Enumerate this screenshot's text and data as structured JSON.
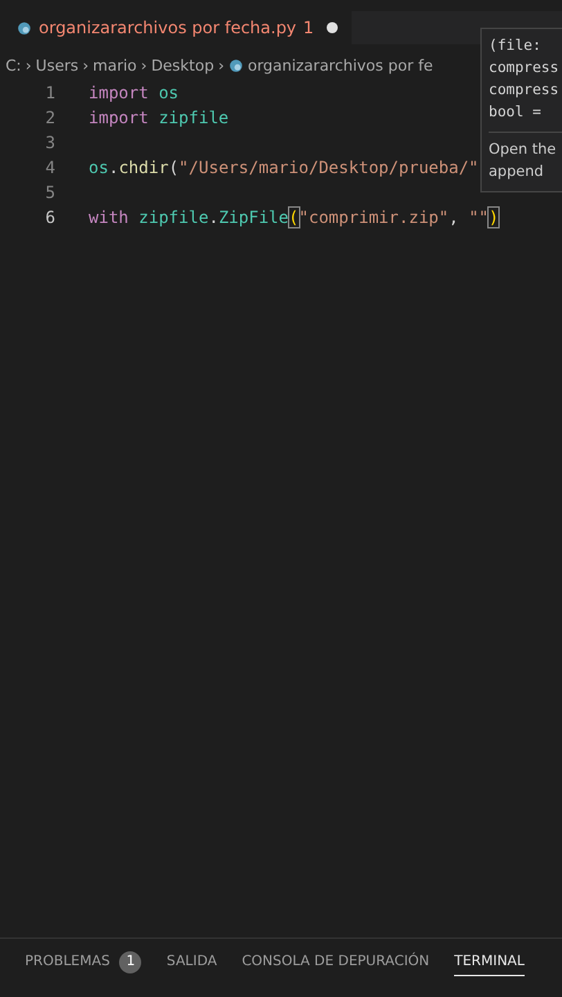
{
  "tabs": [
    {
      "label": "organizararchivos por fecha.py",
      "problems": "1",
      "modified": true,
      "selected": true
    }
  ],
  "breadcrumb": {
    "separator": "›",
    "items": [
      "C:",
      "Users",
      "mario",
      "Desktop",
      "organizararchivos por fe"
    ]
  },
  "code": [
    {
      "number": "1",
      "current": false,
      "tokens": [
        {
          "kind": "keyword",
          "text": "import "
        },
        {
          "kind": "module",
          "text": "os"
        }
      ]
    },
    {
      "number": "2",
      "current": false,
      "tokens": [
        {
          "kind": "keyword",
          "text": "import "
        },
        {
          "kind": "module",
          "text": "zipfile"
        }
      ]
    },
    {
      "number": "3",
      "current": false
    },
    {
      "number": "4",
      "current": false,
      "tokens": [
        {
          "kind": "module",
          "text": "os"
        },
        {
          "kind": "plain",
          "text": "."
        },
        {
          "kind": "function",
          "text": "chdir"
        },
        {
          "kind": "plain",
          "text": "("
        },
        {
          "kind": "string",
          "text": "\"/Users/mario/Desktop/prueba/\""
        }
      ]
    },
    {
      "number": "5",
      "current": false
    },
    {
      "number": "6",
      "current": true,
      "tokens": [
        {
          "kind": "keyword",
          "text": "with "
        },
        {
          "kind": "module",
          "text": "zipfile"
        },
        {
          "kind": "plain",
          "text": "."
        },
        {
          "kind": "class",
          "text": "ZipFile"
        },
        {
          "kind": "bracket",
          "text": "("
        },
        {
          "kind": "string",
          "text": "\"comprimir.zip\""
        },
        {
          "kind": "plain",
          "text": ", "
        },
        {
          "kind": "string",
          "text": "\"\""
        },
        {
          "kind": "bracket",
          "text": ")"
        }
      ]
    }
  ],
  "hover": {
    "signature": [
      "(file:",
      "compress",
      "compress",
      "bool ="
    ],
    "description": [
      "Open the",
      "append"
    ]
  },
  "panel_tabs": [
    {
      "label": "PROBLEMAS",
      "badge": "1",
      "selected": false
    },
    {
      "label": "SALIDA",
      "selected": false
    },
    {
      "label": "CONSOLA DE DEPURACIÓN",
      "selected": false
    },
    {
      "label": "TERMINAL",
      "selected": true
    }
  ]
}
